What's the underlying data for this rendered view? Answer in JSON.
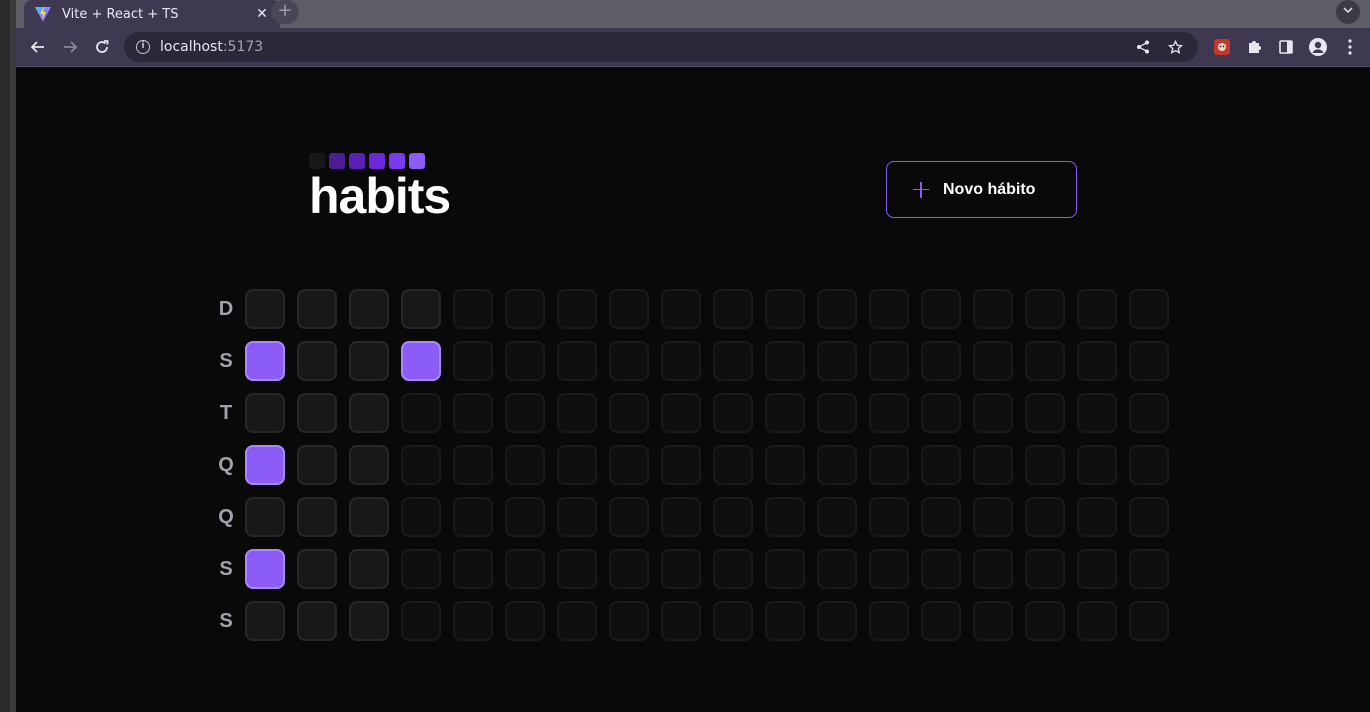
{
  "browser": {
    "tab_title": "Vite + React + TS",
    "tab_close": "✕",
    "new_tab": "+",
    "url_host": "localhost",
    "url_port": ":5173"
  },
  "app": {
    "logo_text": "habits",
    "logo_colors": [
      "#18181b",
      "#4c1d95",
      "#5b21b6",
      "#6d28d9",
      "#7c3aed",
      "#8b5cf6"
    ],
    "new_habit_label": "Novo hábito",
    "accent_color": "#8b5cf6"
  },
  "summary": {
    "weekdays": [
      "D",
      "S",
      "T",
      "Q",
      "Q",
      "S",
      "S"
    ],
    "weeks": [
      [
        "filled",
        "done",
        "filled",
        "done",
        "filled",
        "done",
        "filled"
      ],
      [
        "filled",
        "filled",
        "filled",
        "filled",
        "filled",
        "filled",
        "filled"
      ],
      [
        "filled",
        "filled",
        "filled",
        "filled",
        "filled",
        "filled",
        "filled"
      ],
      [
        "filled",
        "done",
        "empty",
        "empty",
        "empty",
        "empty",
        "empty"
      ],
      [
        "empty",
        "empty",
        "empty",
        "empty",
        "empty",
        "empty",
        "empty"
      ],
      [
        "empty",
        "empty",
        "empty",
        "empty",
        "empty",
        "empty",
        "empty"
      ],
      [
        "empty",
        "empty",
        "empty",
        "empty",
        "empty",
        "empty",
        "empty"
      ],
      [
        "empty",
        "empty",
        "empty",
        "empty",
        "empty",
        "empty",
        "empty"
      ],
      [
        "empty",
        "empty",
        "empty",
        "empty",
        "empty",
        "empty",
        "empty"
      ],
      [
        "empty",
        "empty",
        "empty",
        "empty",
        "empty",
        "empty",
        "empty"
      ],
      [
        "empty",
        "empty",
        "empty",
        "empty",
        "empty",
        "empty",
        "empty"
      ],
      [
        "empty",
        "empty",
        "empty",
        "empty",
        "empty",
        "empty",
        "empty"
      ],
      [
        "empty",
        "empty",
        "empty",
        "empty",
        "empty",
        "empty",
        "empty"
      ],
      [
        "empty",
        "empty",
        "empty",
        "empty",
        "empty",
        "empty",
        "empty"
      ],
      [
        "empty",
        "empty",
        "empty",
        "empty",
        "empty",
        "empty",
        "empty"
      ],
      [
        "empty",
        "empty",
        "empty",
        "empty",
        "empty",
        "empty",
        "empty"
      ],
      [
        "empty",
        "empty",
        "empty",
        "empty",
        "empty",
        "empty",
        "empty"
      ],
      [
        "empty",
        "empty",
        "empty",
        "empty",
        "empty",
        "empty",
        "empty"
      ]
    ]
  }
}
